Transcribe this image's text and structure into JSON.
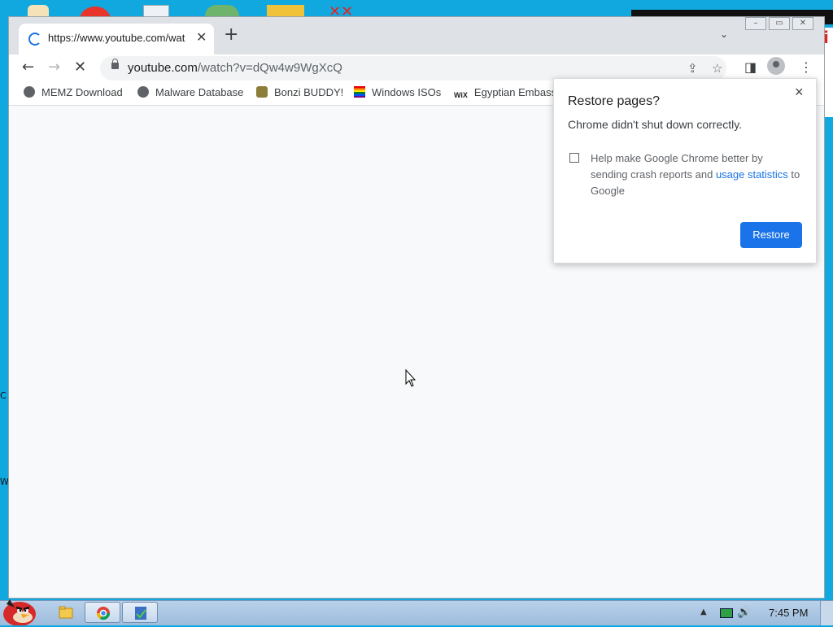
{
  "browser": {
    "tab": {
      "title": "https://www.youtube.com/wat",
      "close": "✕"
    },
    "new_tab": "+",
    "url": {
      "host": "youtube.com",
      "path": "/watch?v=dQw4w9WgXcQ"
    }
  },
  "bookmarks": [
    {
      "label": "MEMZ Download",
      "icon": "globe-icon"
    },
    {
      "label": "Malware Database",
      "icon": "globe-icon"
    },
    {
      "label": "Bonzi BUDDY!",
      "icon": "bonzi-icon"
    },
    {
      "label": "Windows ISOs",
      "icon": "rainbow-flag-icon"
    },
    {
      "label": "Egyptian Embassy",
      "icon": "wix-icon",
      "icon_text": "WiX"
    }
  ],
  "popup": {
    "title": "Restore pages?",
    "message": "Chrome didn't shut down correctly.",
    "checkbox_text_1": "Help make Google Chrome better by sending crash reports and ",
    "checkbox_link": "usage statistics",
    "checkbox_text_2": " to Google",
    "restore_label": "Restore",
    "close": "×"
  },
  "taskbar": {
    "clock": "7:45 PM"
  },
  "desktop_glimpses": [
    "C",
    "W"
  ],
  "colors": {
    "accent": "#1a73e8",
    "desktop": "#11a8e0"
  }
}
